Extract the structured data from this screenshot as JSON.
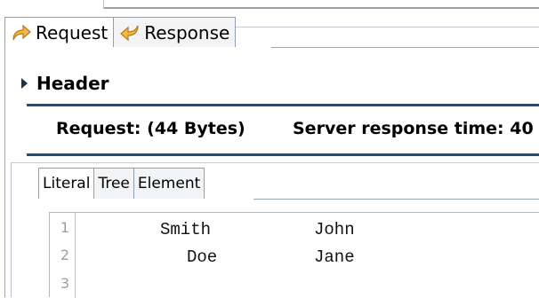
{
  "main_tabs": [
    {
      "label": "Request",
      "icon": "request-arrow-icon",
      "active": true
    },
    {
      "label": "Response",
      "icon": "response-arrow-icon",
      "active": false
    }
  ],
  "header": {
    "label": "Header",
    "icon": "collapse-triangle-icon"
  },
  "info": {
    "request_size": "Request:  (44 Bytes)",
    "server_time": "Server response time: 40"
  },
  "sub_tabs": [
    {
      "label": "Literal",
      "active": true
    },
    {
      "label": "Tree",
      "active": false
    },
    {
      "label": "Element",
      "active": false
    }
  ],
  "editor": {
    "line_numbers": [
      "1",
      "2",
      "3"
    ],
    "rows": [
      {
        "c1": "Smith",
        "c2": "John"
      },
      {
        "c1": "Doe",
        "c2": "Jane"
      }
    ]
  },
  "colors": {
    "separator": "#1f4a7a",
    "tab_border": "#8f9fb4",
    "icon_fill": "#f5b83a"
  }
}
